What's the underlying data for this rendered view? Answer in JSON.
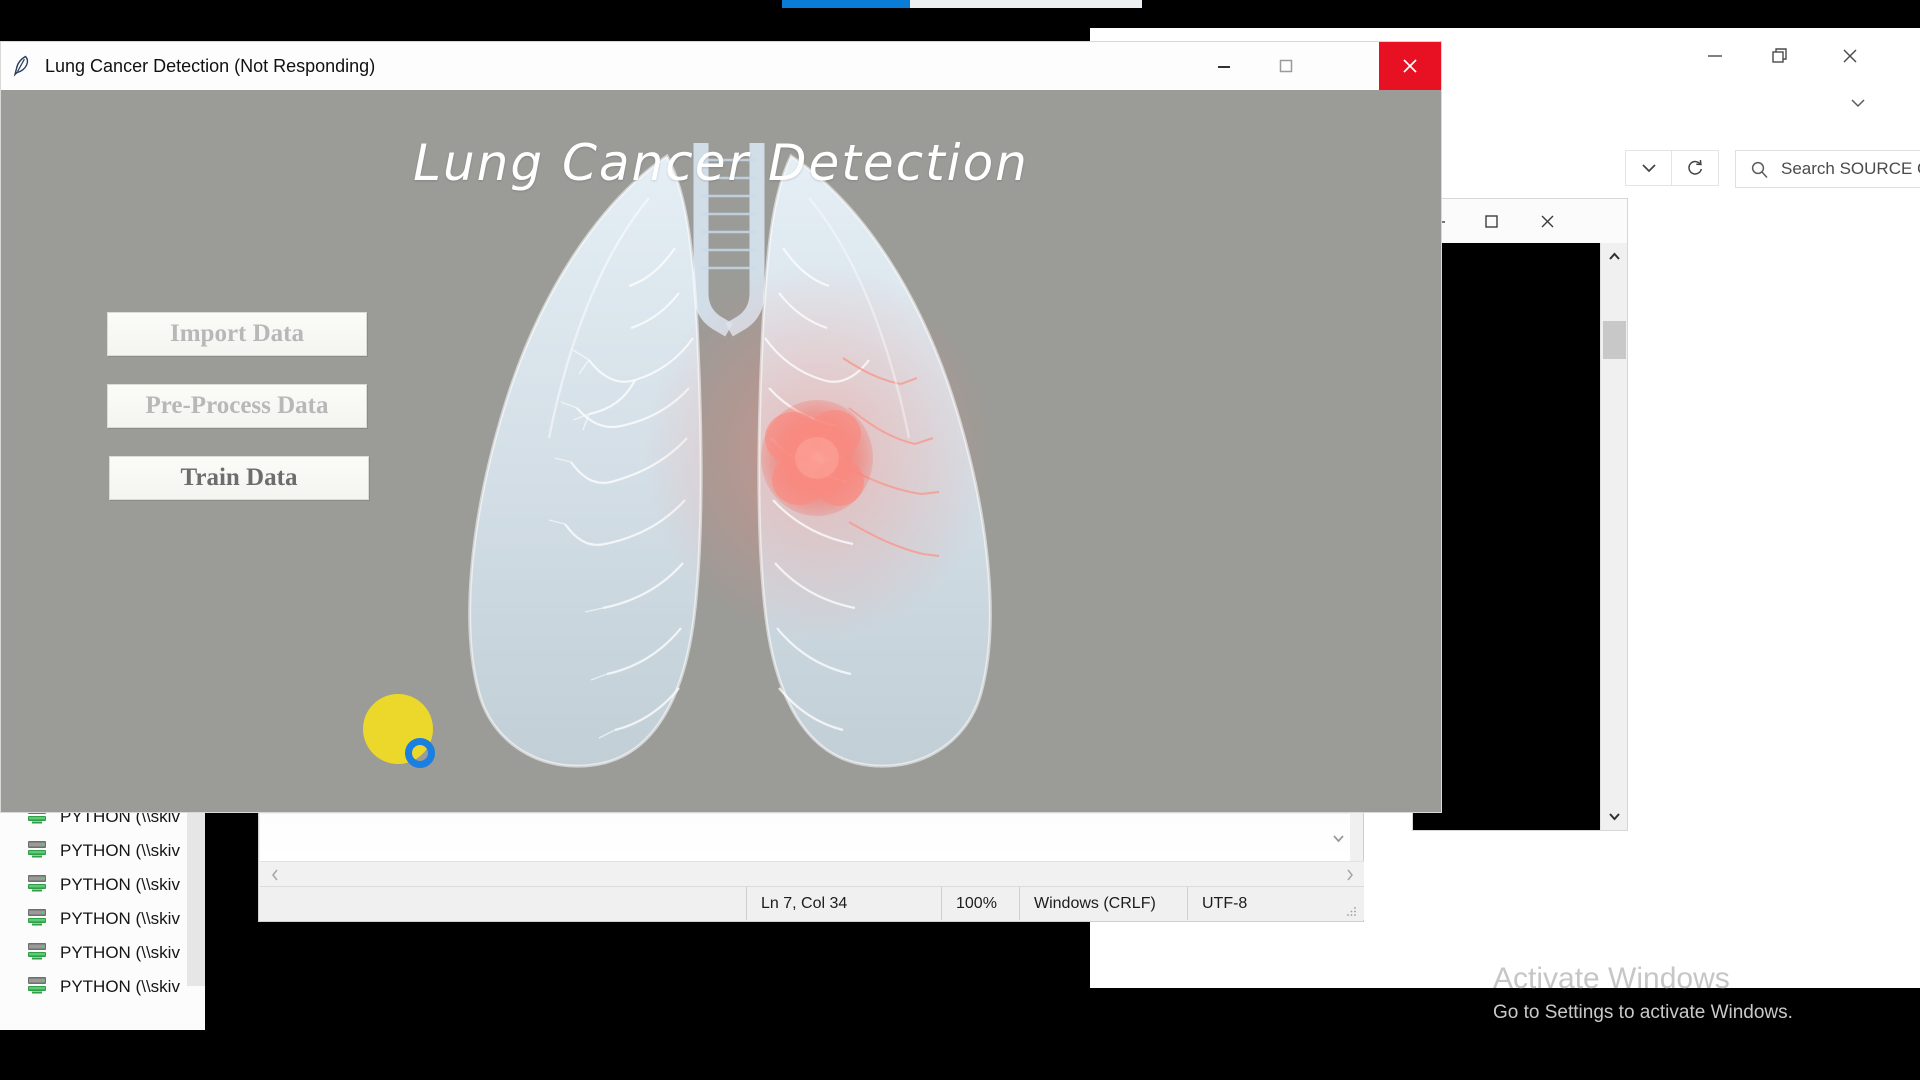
{
  "top_progress": {
    "name": "download-progress",
    "percent": 36
  },
  "app_window": {
    "title": "Lung Cancer Detection (Not Responding)",
    "icon": "python-feather-icon",
    "heading": "Lung Cancer Detection",
    "controls": {
      "minimize": "–",
      "maximize": "☐",
      "close": "✕"
    },
    "close_color": "#e81123",
    "canvas_bg": "#9b9b97",
    "buttons": [
      {
        "label": "Import Data",
        "state": "disabled"
      },
      {
        "label": "Pre-Process Data",
        "state": "disabled"
      },
      {
        "label": "Train Data",
        "state": "enabled"
      }
    ],
    "artwork": {
      "name": "lung-illustration",
      "description": "translucent pair of lungs with bronchial tree and red tumor mass in right lung",
      "lung_color": "#dfeaf2",
      "tumor_color": "#f4776f"
    },
    "pointer": {
      "halo_color": "#f2dd22",
      "ring_color": "#1a7fe0"
    }
  },
  "explorer_window": {
    "controls": {
      "minimize": "–",
      "restore": "❐",
      "close": "✕"
    },
    "chevron": "⌄",
    "address_chevron": "⌄",
    "refresh": "↻",
    "search": {
      "placeholder": "Search SOURCE C..",
      "icon": "search-icon"
    }
  },
  "console_window": {
    "controls": {
      "minimize": "–",
      "maximize": "☐",
      "close": "✕"
    },
    "background": "#000000",
    "scrollbar": {
      "up": "⌃",
      "down": "⌄"
    }
  },
  "editor_window": {
    "h_scroll": {
      "left": "‹",
      "right": "›"
    },
    "v_chevron": "⌄",
    "status_bar": {
      "blank": "",
      "position": "Ln 7, Col 34",
      "zoom": "100%",
      "eol": "Windows (CRLF)",
      "encoding": "UTF-8"
    }
  },
  "drive_list": {
    "items": [
      {
        "label": "PYTHON (\\\\skiv",
        "icon": "network-drive-icon"
      },
      {
        "label": "PYTHON (\\\\skiv",
        "icon": "network-drive-icon"
      },
      {
        "label": "PYTHON (\\\\skiv",
        "icon": "network-drive-icon"
      },
      {
        "label": "PYTHON (\\\\skiv",
        "icon": "network-drive-icon"
      },
      {
        "label": "PYTHON (\\\\skiv",
        "icon": "network-drive-icon"
      },
      {
        "label": "PYTHON (\\\\skiv",
        "icon": "network-drive-icon"
      }
    ]
  },
  "watermark": {
    "title": "Activate Windows",
    "subtitle": "Go to Settings to activate Windows."
  }
}
